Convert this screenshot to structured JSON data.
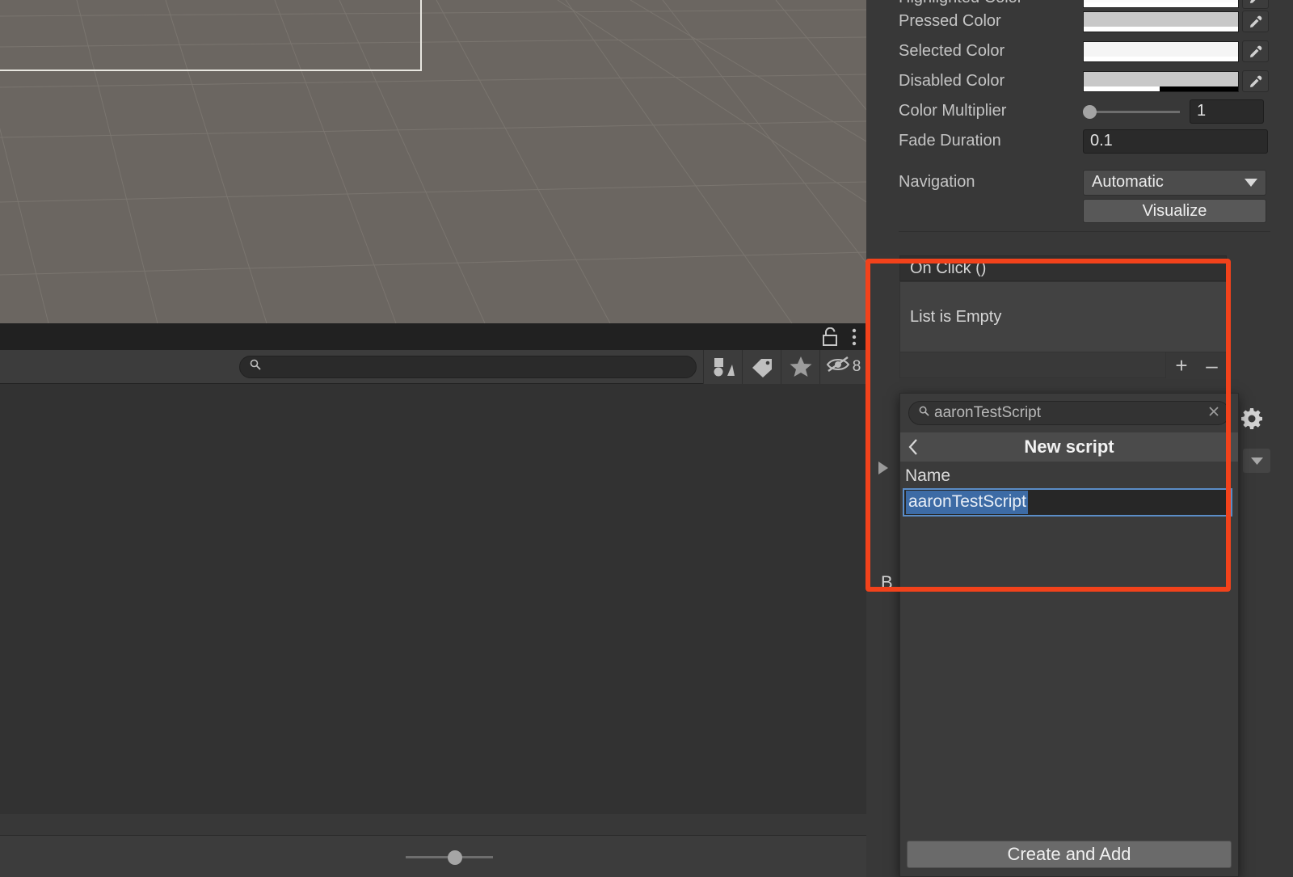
{
  "app": {
    "name": "Unity Editor",
    "theme_bg": "#383838",
    "accent_red": "#f2421b",
    "accent_blue": "#3d6ba5"
  },
  "scene": {
    "name": "scene-viewport",
    "background_color": "#6b6661",
    "grid_color": "#7a756f",
    "canvas_outline_color": "#e8e6e0"
  },
  "inspector": {
    "rows": [
      {
        "label": "Highlighted Color",
        "type": "color",
        "swatch": "#fbfbfb",
        "alpha_pct": 100
      },
      {
        "label": "Pressed Color",
        "type": "color",
        "swatch": "#c8c8c8",
        "alpha_pct": 100
      },
      {
        "label": "Selected Color",
        "type": "color",
        "swatch": "#f5f5f5",
        "alpha_pct": 100
      },
      {
        "label": "Disabled Color",
        "type": "color",
        "swatch": "#c8c8c8",
        "alpha_pct": 49
      }
    ],
    "color_multiplier": {
      "label": "Color Multiplier",
      "value": "1",
      "slider_pct": 0
    },
    "fade_duration": {
      "label": "Fade Duration",
      "value": "0.1"
    },
    "navigation": {
      "label": "Navigation",
      "value": "Automatic"
    },
    "visualize_button": "Visualize",
    "eyedropper_icon": "eyedropper-icon",
    "chevron_down_icon": "chevron-down-icon",
    "gear_icon": "gear-icon"
  },
  "on_click": {
    "header": "On Click ()",
    "empty_text": "List is Empty",
    "add_label": "+",
    "remove_label": "–"
  },
  "hierarchy": {
    "search_placeholder": "",
    "search_value": "",
    "search_icon": "search-icon",
    "lock_icon": "lock-icon",
    "kebab_icon": "kebab-menu-icon",
    "toolbar_icons": [
      {
        "name": "shapes-filter-icon"
      },
      {
        "name": "tag-icon"
      },
      {
        "name": "favorite-star-icon"
      },
      {
        "name": "hidden-objects-icon",
        "count": "8"
      }
    ],
    "foldout_icon": "foldout-triangle-icon",
    "partial_label": "B",
    "zoom_slider_pct": 50
  },
  "script_popup": {
    "search_value": "aaronTestScript",
    "search_icon": "search-icon",
    "clear_icon": "clear-x-icon",
    "back_icon": "back-chevron-icon",
    "title": "New script",
    "name_label": "Name",
    "name_value": "aaronTestScript",
    "name_selected": true,
    "create_button": "Create and Add"
  }
}
